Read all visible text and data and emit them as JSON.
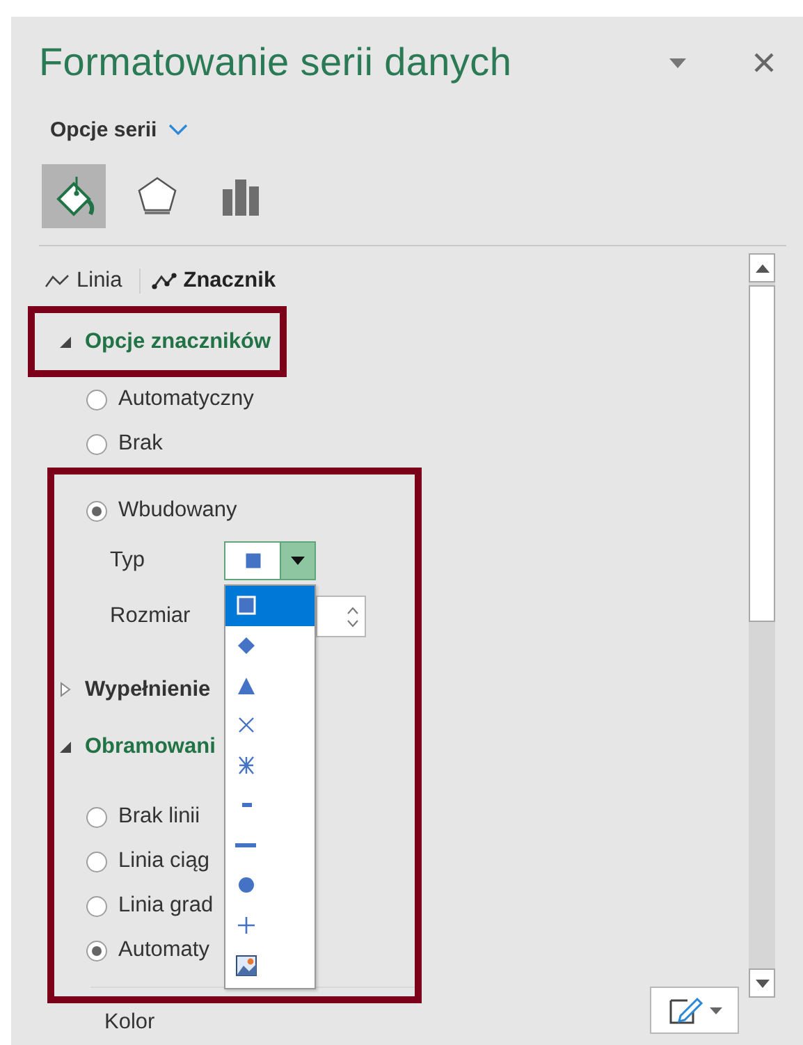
{
  "pane": {
    "title": "Formatowanie serii danych"
  },
  "options_menu": {
    "label": "Opcje serii"
  },
  "category_tabs": [
    {
      "kind": "fill",
      "selected": true
    },
    {
      "kind": "effects",
      "selected": false
    },
    {
      "kind": "series",
      "selected": false
    }
  ],
  "subtabs": [
    {
      "kind": "line",
      "label": "Linia",
      "selected": false
    },
    {
      "kind": "marker",
      "label": "Znacznik",
      "selected": true
    }
  ],
  "marker_options": {
    "title": "Opcje znaczników",
    "expanded": true,
    "options": [
      {
        "label": "Automatyczny",
        "selected": false
      },
      {
        "label": "Brak",
        "selected": false
      },
      {
        "label": "Wbudowany",
        "selected": true
      }
    ],
    "type_label": "Typ",
    "size_label": "Rozmiar"
  },
  "type_dropdown": {
    "open": true,
    "options": [
      {
        "kind": "square",
        "selected": true
      },
      {
        "kind": "diamond",
        "selected": false
      },
      {
        "kind": "triangle",
        "selected": false
      },
      {
        "kind": "x",
        "selected": false
      },
      {
        "kind": "star",
        "selected": false
      },
      {
        "kind": "short-dash",
        "selected": false
      },
      {
        "kind": "long-dash",
        "selected": false
      },
      {
        "kind": "circle",
        "selected": false
      },
      {
        "kind": "plus",
        "selected": false
      },
      {
        "kind": "picture",
        "selected": false
      }
    ]
  },
  "fill_section": {
    "title": "Wypełnienie",
    "expanded": false
  },
  "border_section": {
    "title": "Obramowani",
    "expanded": true,
    "options": [
      {
        "label": "Brak linii",
        "selected": false
      },
      {
        "label": "Linia ciąg",
        "selected": false
      },
      {
        "label": "Linia grad",
        "selected": false
      },
      {
        "label": "Automaty",
        "selected": true
      }
    ],
    "color_label": "Kolor"
  }
}
